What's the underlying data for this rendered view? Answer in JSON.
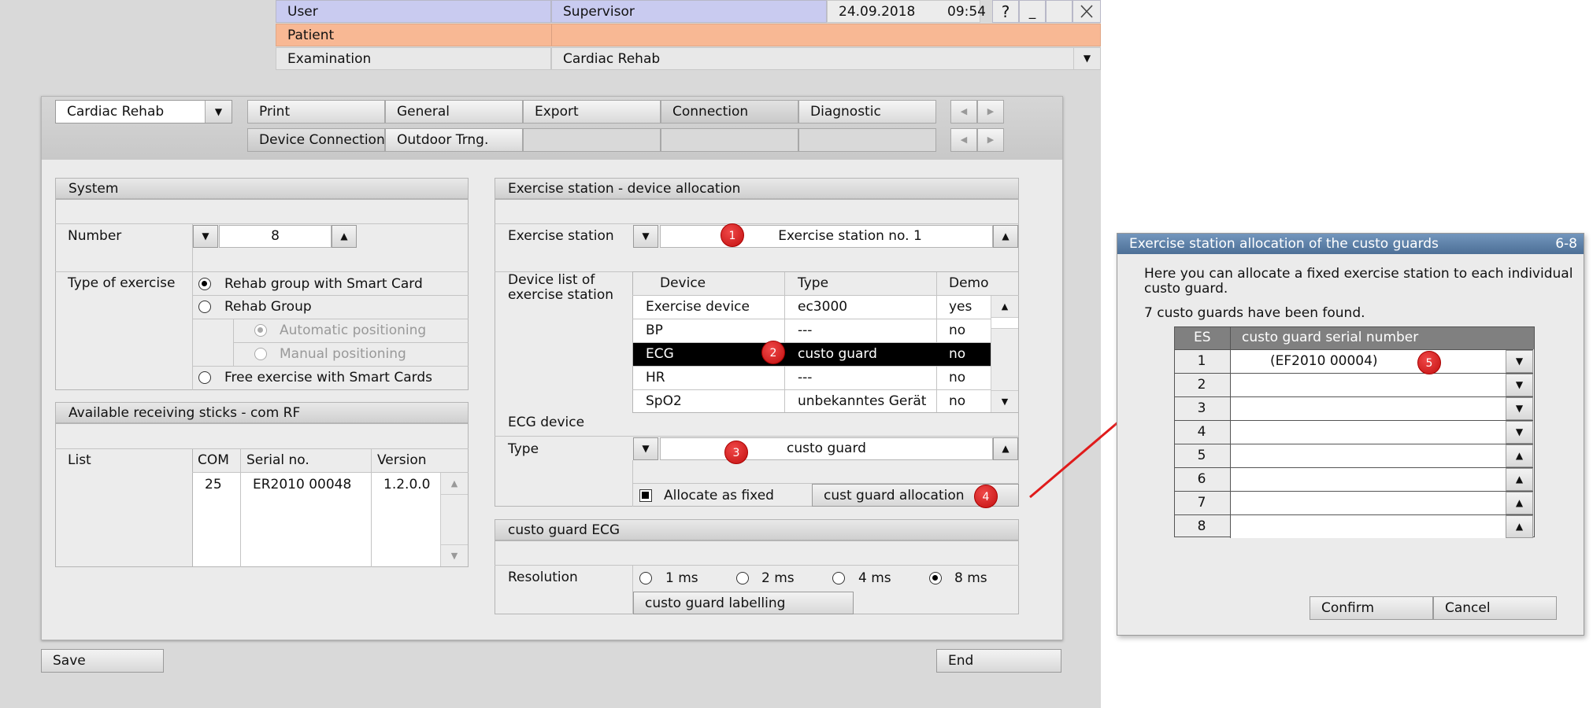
{
  "topbar": {
    "user_label": "User",
    "user_value": "Supervisor",
    "date": "24.09.2018",
    "time": "09:54",
    "help": "?",
    "minimize": "_",
    "patient_label": "Patient",
    "examination_label": "Examination",
    "examination_value": "Cardiac Rehab"
  },
  "program": {
    "selected": "Cardiac Rehab",
    "tabs_row1": [
      "Print",
      "General",
      "Export",
      "Connection",
      "Diagnostic"
    ],
    "tabs_row2": [
      "Device Connection",
      "Outdoor Trng."
    ]
  },
  "system": {
    "title": "System",
    "number_label": "Number",
    "number_value": "8",
    "type_label": "Type of exercise",
    "options": [
      "Rehab group with Smart Card",
      "Rehab Group",
      "Automatic positioning",
      "Manual positioning",
      "Free exercise with Smart Cards"
    ]
  },
  "sticks": {
    "title": "Available receiving sticks - com RF",
    "list_label": "List",
    "headers": [
      "COM",
      "Serial no.",
      "Version"
    ],
    "rows": [
      [
        "25",
        "ER2010 00048",
        "1.2.0.0"
      ]
    ]
  },
  "allocation": {
    "title": "Exercise station - device allocation",
    "station_label": "Exercise station",
    "station_value": "Exercise station no. 1",
    "device_list_label": "Device list of exercise station",
    "headers": [
      "Device",
      "Type",
      "Demo"
    ],
    "rows": [
      [
        "Exercise device",
        "ec3000",
        "yes"
      ],
      [
        "BP",
        "---",
        "no"
      ],
      [
        "ECG",
        "custo guard",
        "no"
      ],
      [
        "HR",
        "---",
        "no"
      ],
      [
        "SpO2",
        "unbekanntes Gerät",
        "no"
      ]
    ],
    "ecg_device_label": "ECG device",
    "type_label": "Type",
    "type_value": "custo guard",
    "allocate_label": "Allocate as fixed",
    "cust_guard_button": "cust guard allocation"
  },
  "ecg": {
    "title": "custo guard ECG",
    "resolution_label": "Resolution",
    "options": [
      "1 ms",
      "2 ms",
      "4 ms",
      "8 ms"
    ],
    "labelling_button": "custo guard labelling"
  },
  "footer": {
    "save": "Save",
    "end": "End"
  },
  "badges": [
    "1",
    "2",
    "3",
    "4",
    "5"
  ],
  "dialog": {
    "title": "Exercise station allocation of the custo guards",
    "code": "6-8",
    "intro": "Here you can allocate a fixed exercise station to each individual custo guard.",
    "found": "7 custo guards have been found.",
    "headers": [
      "ES",
      "custo guard serial number"
    ],
    "rows": [
      [
        "1",
        "(EF2010 00004)"
      ],
      [
        "2",
        ""
      ],
      [
        "3",
        ""
      ],
      [
        "4",
        ""
      ],
      [
        "5",
        ""
      ],
      [
        "6",
        ""
      ],
      [
        "7",
        ""
      ],
      [
        "8",
        ""
      ]
    ],
    "confirm": "Confirm",
    "cancel": "Cancel"
  },
  "colors": {
    "user_row": "#c9cbf0",
    "patient_row": "#f8b894",
    "dialog_title": "#5a7fa8",
    "annotation_red": "#d21f1f",
    "panel_bg": "#dcdcdc"
  }
}
